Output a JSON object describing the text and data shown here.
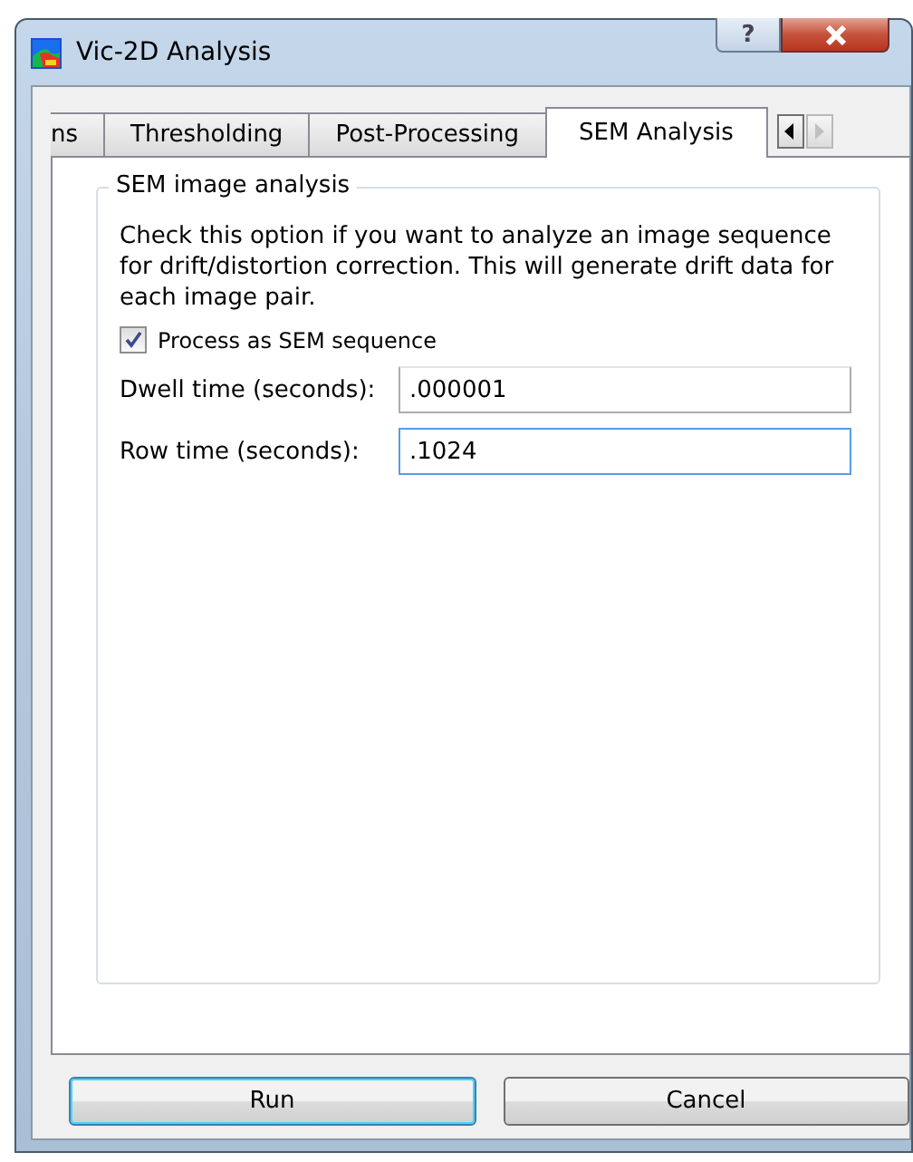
{
  "window": {
    "title": "Vic-2D Analysis",
    "help_button": "?"
  },
  "tabs": [
    {
      "label": "ns",
      "selected": false
    },
    {
      "label": "Thresholding",
      "selected": false
    },
    {
      "label": "Post-Processing",
      "selected": false
    },
    {
      "label": "SEM Analysis",
      "selected": true
    }
  ],
  "group": {
    "title": "SEM image analysis",
    "description": "Check this option if you want to analyze an image sequence for drift/distortion correction. This will generate drift data for each image pair.",
    "checkbox": {
      "label": "Process as SEM sequence",
      "checked": true
    },
    "fields": [
      {
        "label": "Dwell time (seconds):",
        "value": ".000001",
        "focused": false
      },
      {
        "label": "Row time (seconds):",
        "value": ".1024",
        "focused": true
      }
    ]
  },
  "buttons": [
    {
      "label": "Run",
      "default": true
    },
    {
      "label": "Cancel",
      "default": false
    }
  ]
}
